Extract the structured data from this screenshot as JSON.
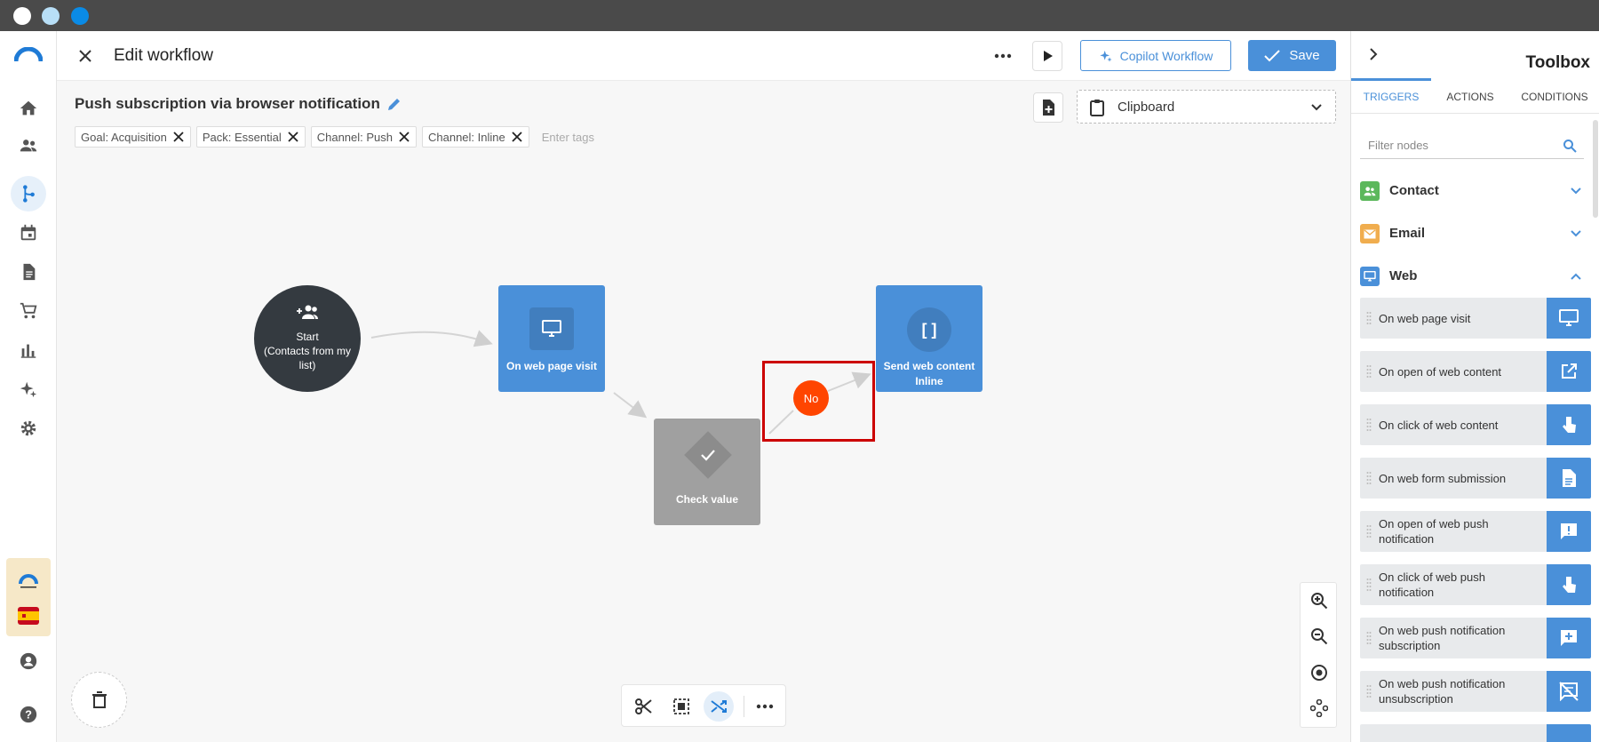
{
  "colors": {
    "accent": "#4a90d9",
    "start_node": "#343a40",
    "check_node": "#a0a0a0",
    "no_label": "#ff4500",
    "highlight": "#cc0000"
  },
  "header": {
    "title": "Edit workflow",
    "copilot_label": "Copilot Workflow",
    "save_label": "Save"
  },
  "workflow": {
    "name": "Push subscription via browser notification",
    "tags": [
      "Goal: Acquisition",
      "Pack: Essential",
      "Channel: Push",
      "Channel: Inline"
    ],
    "tags_placeholder": "Enter tags"
  },
  "clipboard": {
    "label": "Clipboard"
  },
  "canvas": {
    "nodes": {
      "start": "Start\n(Contacts from my list)",
      "start_l1": "Start",
      "start_l2": "(Contacts from my",
      "start_l3": "list)",
      "visit": "On web page visit",
      "check": "Check value",
      "send_l1": "Send web content",
      "send_l2": "Inline"
    },
    "no_label": "No"
  },
  "toolbox": {
    "title": "Toolbox",
    "tabs": [
      "TRIGGERS",
      "ACTIONS",
      "CONDITIONS"
    ],
    "filter_placeholder": "Filter nodes",
    "categories": [
      {
        "label": "Contact",
        "icon": "people-icon",
        "color": "#5cb85c"
      },
      {
        "label": "Email",
        "icon": "mail-icon",
        "color": "#f0ad4e"
      },
      {
        "label": "Web",
        "icon": "monitor-icon",
        "color": "#4a90d9"
      }
    ],
    "items": [
      {
        "label": "On web page visit",
        "icon": "monitor-icon"
      },
      {
        "label": "On open of web content",
        "icon": "open-external-icon"
      },
      {
        "label": "On click of web content",
        "icon": "pointer-icon"
      },
      {
        "label": "On web form submission",
        "icon": "document-icon"
      },
      {
        "label": "On open of web push notification",
        "icon": "chat-alert-icon"
      },
      {
        "label": "On click of web push notification",
        "icon": "pointer-icon"
      },
      {
        "label": "On web push notification subscription",
        "icon": "chat-plus-icon"
      },
      {
        "label": "On web push notification unsubscription",
        "icon": "chat-off-icon"
      }
    ]
  }
}
